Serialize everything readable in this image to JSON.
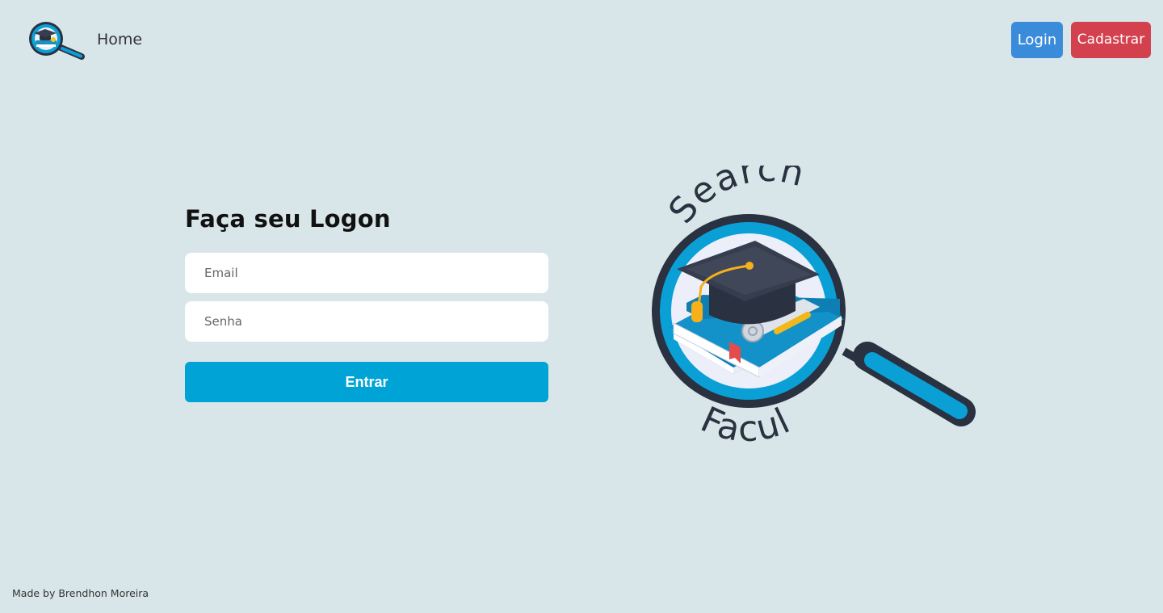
{
  "nav": {
    "home_label": "Home",
    "login_label": "Login",
    "signup_label": "Cadastrar"
  },
  "form": {
    "title": "Faça seu Logon",
    "email_placeholder": "Email",
    "password_placeholder": "Senha",
    "submit_label": "Entrar"
  },
  "logo": {
    "top_text": "Search",
    "bottom_text": "Facul"
  },
  "footer": {
    "credit": "Made by Brendhon Moreira"
  },
  "colors": {
    "background": "#d8e6e9",
    "login_button": "#3b8bdb",
    "signup_button": "#d3414f",
    "submit_button": "#00a3d6",
    "logo_blue": "#0aa0d6",
    "logo_dark": "#2a3140"
  }
}
